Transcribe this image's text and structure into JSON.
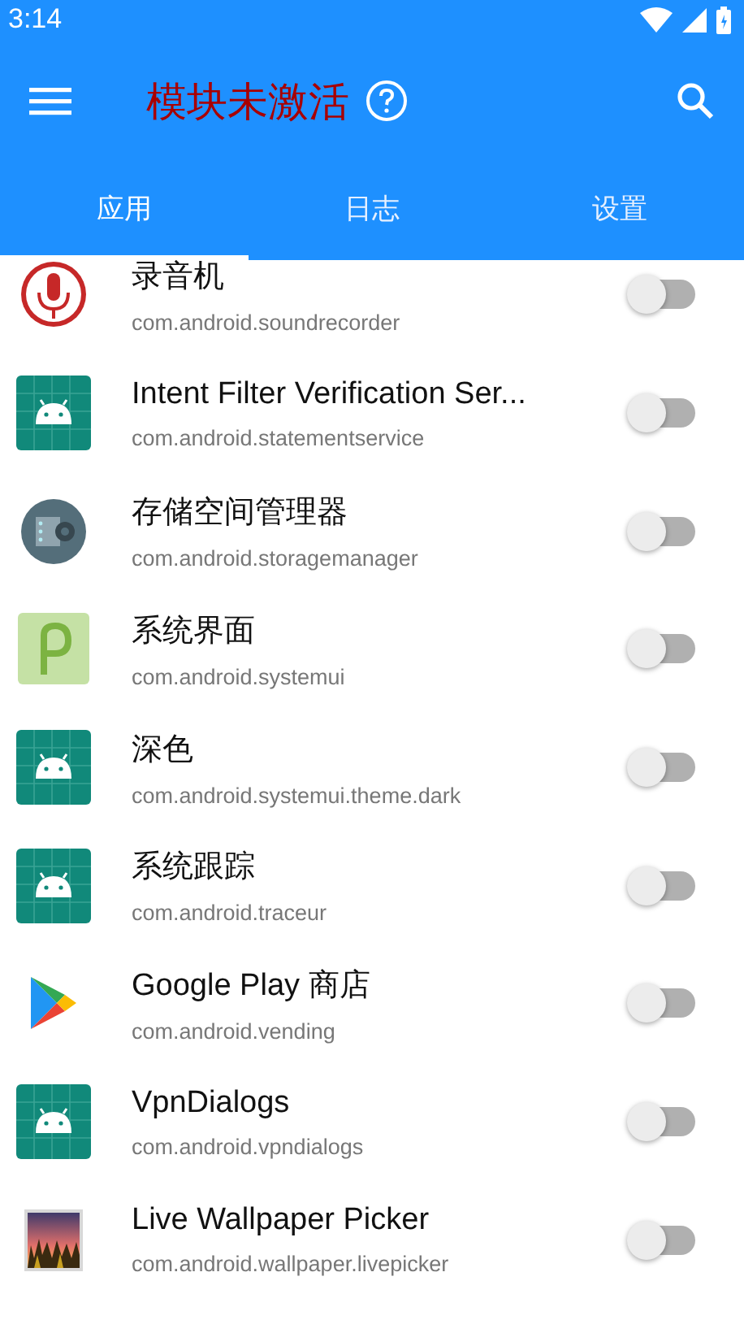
{
  "status_bar": {
    "time": "3:14"
  },
  "toolbar": {
    "title": "模块未激活"
  },
  "tabs": [
    {
      "label": "应用",
      "selected": true
    },
    {
      "label": "日志",
      "selected": false
    },
    {
      "label": "设置",
      "selected": false
    }
  ],
  "apps": [
    {
      "kind": "recorder",
      "name": "录音机",
      "package": "com.android.soundrecorder",
      "on": false
    },
    {
      "kind": "android",
      "name": "Intent Filter Verification Ser...",
      "package": "com.android.statementservice",
      "on": false
    },
    {
      "kind": "storage",
      "name": "存储空间管理器",
      "package": "com.android.storagemanager",
      "on": false
    },
    {
      "kind": "systemui",
      "name": "系统界面",
      "package": "com.android.systemui",
      "on": false
    },
    {
      "kind": "android",
      "name": "深色",
      "package": "com.android.systemui.theme.dark",
      "on": false
    },
    {
      "kind": "android",
      "name": "系统跟踪",
      "package": "com.android.traceur",
      "on": false
    },
    {
      "kind": "play",
      "name": "Google Play 商店",
      "package": "com.android.vending",
      "on": false
    },
    {
      "kind": "android",
      "name": "VpnDialogs",
      "package": "com.android.vpndialogs",
      "on": false
    },
    {
      "kind": "wallpaper",
      "name": "Live Wallpaper Picker",
      "package": "com.android.wallpaper.livepicker",
      "on": false
    }
  ]
}
